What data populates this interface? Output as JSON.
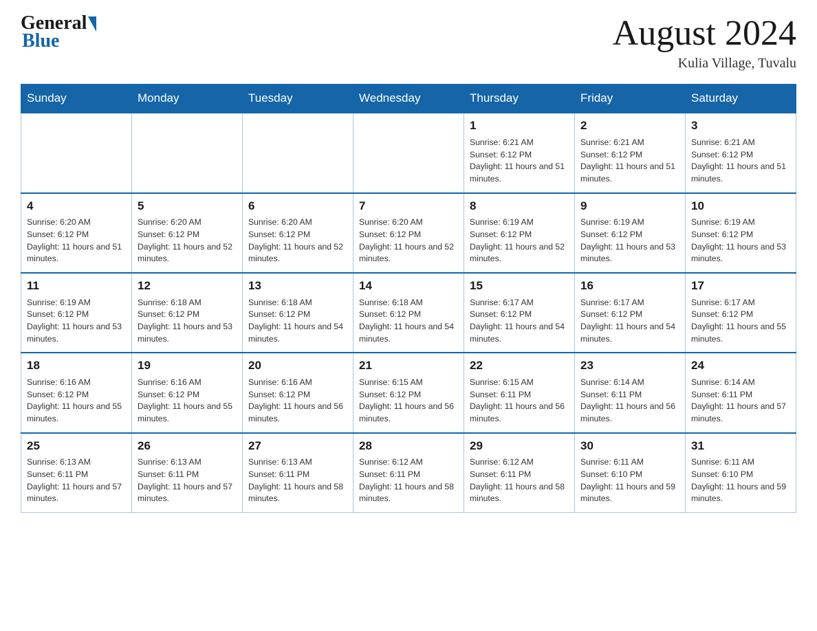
{
  "header": {
    "logo_general": "General",
    "logo_blue": "Blue",
    "month_title": "August 2024",
    "location": "Kulia Village, Tuvalu"
  },
  "weekdays": [
    "Sunday",
    "Monday",
    "Tuesday",
    "Wednesday",
    "Thursday",
    "Friday",
    "Saturday"
  ],
  "weeks": [
    [
      {
        "day": "",
        "info": ""
      },
      {
        "day": "",
        "info": ""
      },
      {
        "day": "",
        "info": ""
      },
      {
        "day": "",
        "info": ""
      },
      {
        "day": "1",
        "info": "Sunrise: 6:21 AM\nSunset: 6:12 PM\nDaylight: 11 hours and 51 minutes."
      },
      {
        "day": "2",
        "info": "Sunrise: 6:21 AM\nSunset: 6:12 PM\nDaylight: 11 hours and 51 minutes."
      },
      {
        "day": "3",
        "info": "Sunrise: 6:21 AM\nSunset: 6:12 PM\nDaylight: 11 hours and 51 minutes."
      }
    ],
    [
      {
        "day": "4",
        "info": "Sunrise: 6:20 AM\nSunset: 6:12 PM\nDaylight: 11 hours and 51 minutes."
      },
      {
        "day": "5",
        "info": "Sunrise: 6:20 AM\nSunset: 6:12 PM\nDaylight: 11 hours and 52 minutes."
      },
      {
        "day": "6",
        "info": "Sunrise: 6:20 AM\nSunset: 6:12 PM\nDaylight: 11 hours and 52 minutes."
      },
      {
        "day": "7",
        "info": "Sunrise: 6:20 AM\nSunset: 6:12 PM\nDaylight: 11 hours and 52 minutes."
      },
      {
        "day": "8",
        "info": "Sunrise: 6:19 AM\nSunset: 6:12 PM\nDaylight: 11 hours and 52 minutes."
      },
      {
        "day": "9",
        "info": "Sunrise: 6:19 AM\nSunset: 6:12 PM\nDaylight: 11 hours and 53 minutes."
      },
      {
        "day": "10",
        "info": "Sunrise: 6:19 AM\nSunset: 6:12 PM\nDaylight: 11 hours and 53 minutes."
      }
    ],
    [
      {
        "day": "11",
        "info": "Sunrise: 6:19 AM\nSunset: 6:12 PM\nDaylight: 11 hours and 53 minutes."
      },
      {
        "day": "12",
        "info": "Sunrise: 6:18 AM\nSunset: 6:12 PM\nDaylight: 11 hours and 53 minutes."
      },
      {
        "day": "13",
        "info": "Sunrise: 6:18 AM\nSunset: 6:12 PM\nDaylight: 11 hours and 54 minutes."
      },
      {
        "day": "14",
        "info": "Sunrise: 6:18 AM\nSunset: 6:12 PM\nDaylight: 11 hours and 54 minutes."
      },
      {
        "day": "15",
        "info": "Sunrise: 6:17 AM\nSunset: 6:12 PM\nDaylight: 11 hours and 54 minutes."
      },
      {
        "day": "16",
        "info": "Sunrise: 6:17 AM\nSunset: 6:12 PM\nDaylight: 11 hours and 54 minutes."
      },
      {
        "day": "17",
        "info": "Sunrise: 6:17 AM\nSunset: 6:12 PM\nDaylight: 11 hours and 55 minutes."
      }
    ],
    [
      {
        "day": "18",
        "info": "Sunrise: 6:16 AM\nSunset: 6:12 PM\nDaylight: 11 hours and 55 minutes."
      },
      {
        "day": "19",
        "info": "Sunrise: 6:16 AM\nSunset: 6:12 PM\nDaylight: 11 hours and 55 minutes."
      },
      {
        "day": "20",
        "info": "Sunrise: 6:16 AM\nSunset: 6:12 PM\nDaylight: 11 hours and 56 minutes."
      },
      {
        "day": "21",
        "info": "Sunrise: 6:15 AM\nSunset: 6:12 PM\nDaylight: 11 hours and 56 minutes."
      },
      {
        "day": "22",
        "info": "Sunrise: 6:15 AM\nSunset: 6:11 PM\nDaylight: 11 hours and 56 minutes."
      },
      {
        "day": "23",
        "info": "Sunrise: 6:14 AM\nSunset: 6:11 PM\nDaylight: 11 hours and 56 minutes."
      },
      {
        "day": "24",
        "info": "Sunrise: 6:14 AM\nSunset: 6:11 PM\nDaylight: 11 hours and 57 minutes."
      }
    ],
    [
      {
        "day": "25",
        "info": "Sunrise: 6:13 AM\nSunset: 6:11 PM\nDaylight: 11 hours and 57 minutes."
      },
      {
        "day": "26",
        "info": "Sunrise: 6:13 AM\nSunset: 6:11 PM\nDaylight: 11 hours and 57 minutes."
      },
      {
        "day": "27",
        "info": "Sunrise: 6:13 AM\nSunset: 6:11 PM\nDaylight: 11 hours and 58 minutes."
      },
      {
        "day": "28",
        "info": "Sunrise: 6:12 AM\nSunset: 6:11 PM\nDaylight: 11 hours and 58 minutes."
      },
      {
        "day": "29",
        "info": "Sunrise: 6:12 AM\nSunset: 6:11 PM\nDaylight: 11 hours and 58 minutes."
      },
      {
        "day": "30",
        "info": "Sunrise: 6:11 AM\nSunset: 6:10 PM\nDaylight: 11 hours and 59 minutes."
      },
      {
        "day": "31",
        "info": "Sunrise: 6:11 AM\nSunset: 6:10 PM\nDaylight: 11 hours and 59 minutes."
      }
    ]
  ]
}
